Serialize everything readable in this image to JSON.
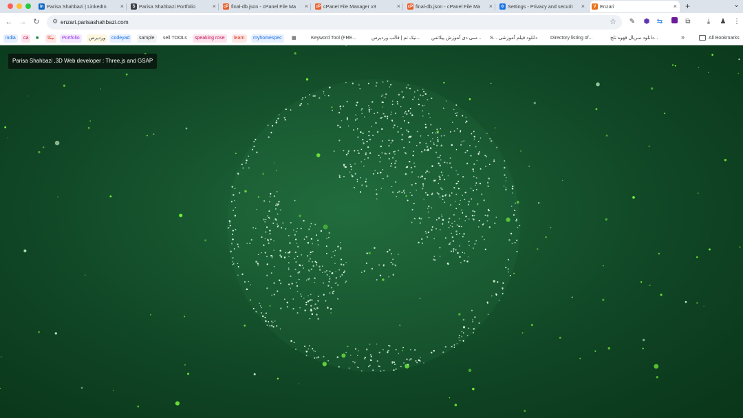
{
  "browser": {
    "tabs": [
      {
        "label": "Parisa Shahbazi | LinkedIn",
        "icon": "linkedin-icon",
        "color": "#0a66c2",
        "glyph": "in"
      },
      {
        "label": "Parisa Shahbazi Portfolio",
        "icon": "portfolio-s-icon",
        "color": "#3c4043",
        "glyph": "S"
      },
      {
        "label": "final-db.json - cPanel File Ma",
        "icon": "cpanel-icon",
        "color": "#e95d27",
        "glyph": "cP"
      },
      {
        "label": "cPanel File Manager v3",
        "icon": "cpanel-icon",
        "color": "#e95d27",
        "glyph": "cP"
      },
      {
        "label": "final-db.json - cPanel File Ma",
        "icon": "cpanel-icon",
        "color": "#e95d27",
        "glyph": "cP"
      },
      {
        "label": "Settings - Privacy and securit",
        "icon": "settings-gear-icon",
        "color": "#1a73e8",
        "glyph": "⚙"
      },
      {
        "label": "Enzari",
        "icon": "enzari-v-icon",
        "color": "#e8711a",
        "glyph": "V"
      }
    ],
    "new_tab_glyph": "+",
    "tab_menu_glyph": "⌄",
    "close_glyph": "×",
    "url": "enzari.parisashahbazi.com",
    "nav": {
      "back": "←",
      "forward": "→",
      "reload": "↻"
    },
    "bookmark_star": "☆"
  },
  "bookmarks": [
    {
      "label": "india",
      "color": "#1a73e8",
      "bg": "#e8f0fe"
    },
    {
      "label": "ca",
      "color": "#c2185b",
      "bg": "#fce4ec"
    },
    {
      "label": "■",
      "color": "#188038",
      "bg": "transparent"
    },
    {
      "label": "نیکا",
      "color": "#d93025",
      "bg": "#fce8e6"
    },
    {
      "label": "Portfolio",
      "color": "#9334e6",
      "bg": "#f3e8fd"
    },
    {
      "label": "وردپرس",
      "color": "#3c4043",
      "bg": "#fef7e0"
    },
    {
      "label": "codeyad",
      "color": "#1a73e8",
      "bg": "#e8f0fe"
    },
    {
      "label": "sample",
      "color": "#3c4043",
      "bg": "#f1f3f4"
    },
    {
      "label": "sell TOOLs",
      "color": "#3c4043",
      "bg": "transparent"
    },
    {
      "label": "speaking rose",
      "color": "#c2185b",
      "bg": "#fce4ec"
    },
    {
      "label": "learn",
      "color": "#d93025",
      "bg": "#fce8e6"
    },
    {
      "label": "myhomespec",
      "color": "#1a73e8",
      "bg": "#e8f0fe"
    },
    {
      "label": "▦",
      "color": "#3c4043",
      "bg": "transparent"
    },
    {
      "label": "Keyword Tool (FRE...",
      "color": "#3c4043",
      "bg": "transparent"
    },
    {
      "label": "تیک تم | قالب وردپرس...",
      "color": "#3c4043",
      "bg": "transparent"
    },
    {
      "label": "سی دی آموزش پیلاتس...",
      "color": "#3c4043",
      "bg": "transparent"
    },
    {
      "label": "S... دانلود فیلم آموزشی",
      "color": "#3c4043",
      "bg": "transparent"
    },
    {
      "label": "Directory listing of...",
      "color": "#3c4043",
      "bg": "transparent"
    },
    {
      "label": "دانلود سریال قهوه تلخ...",
      "color": "#3c4043",
      "bg": "transparent"
    }
  ],
  "bookmarks_more": "»",
  "all_bookmarks_label": "All Bookmarks",
  "page": {
    "title_overlay": "Parisa Shahbazi ,3D Web developer : Three.js and GSAP"
  },
  "colors": {
    "accent_green": "#7cff3a",
    "globe_points": "#e8fff0",
    "background_center": "#1f6a3b",
    "background_edge": "#0a3519"
  }
}
